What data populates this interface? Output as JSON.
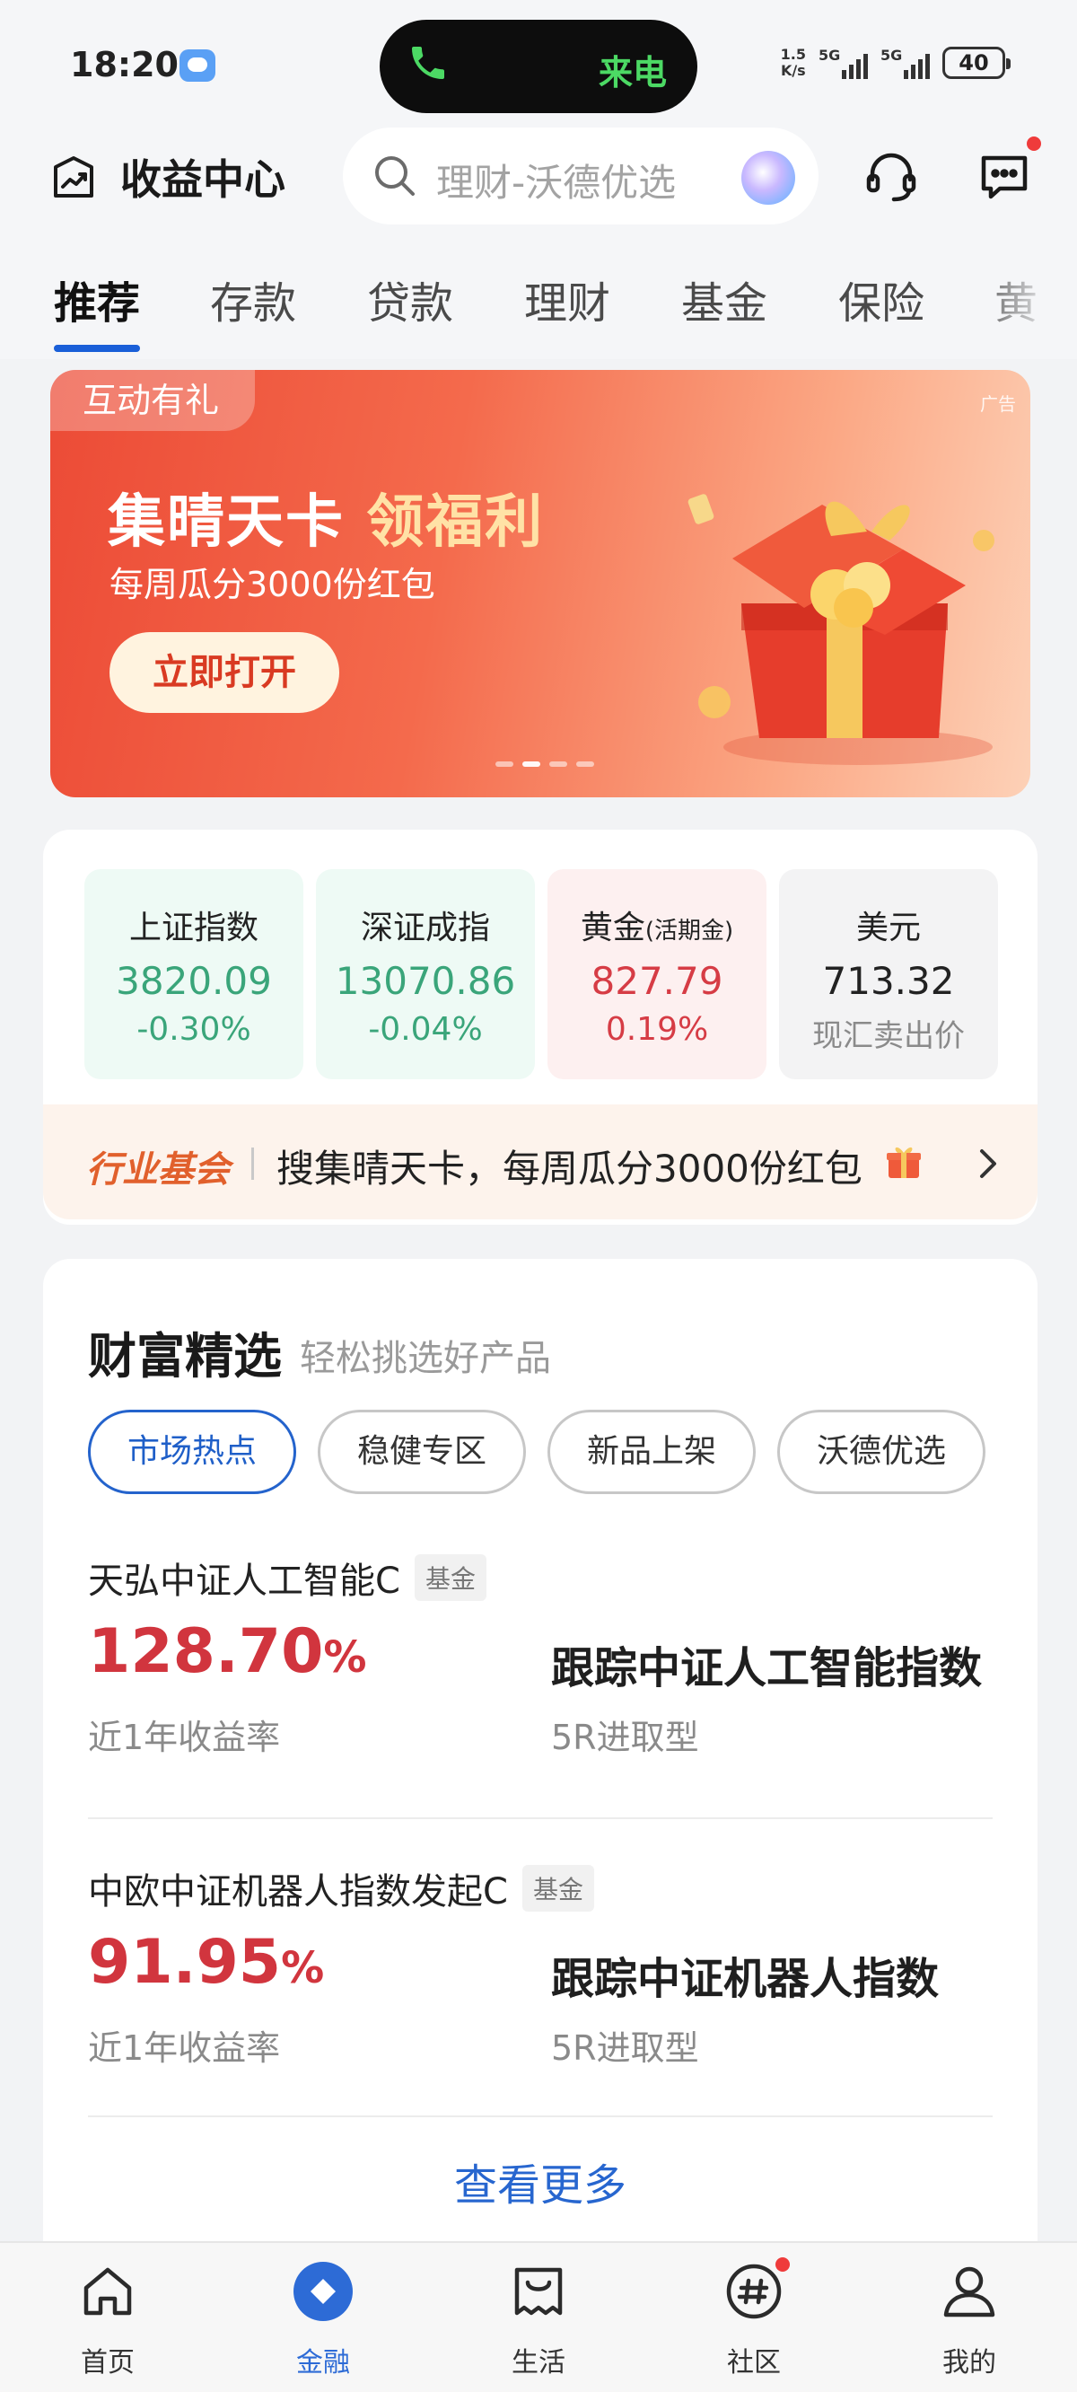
{
  "status_bar": {
    "time": "18:20",
    "call_label": "来电",
    "net_speed_value": "1.5",
    "net_speed_unit": "K/s",
    "signal_1": "5G",
    "signal_2": "5G",
    "battery": "40"
  },
  "header": {
    "title": "收益中心",
    "search_placeholder": "理财-沃德优选"
  },
  "tabs": [
    {
      "label": "推荐",
      "active": true
    },
    {
      "label": "存款"
    },
    {
      "label": "贷款"
    },
    {
      "label": "理财"
    },
    {
      "label": "基金"
    },
    {
      "label": "保险"
    },
    {
      "label": "黄"
    }
  ],
  "banner": {
    "tag": "互动有礼",
    "ad_label": "广告",
    "title_main": "集晴天卡",
    "title_highlight": "领福利",
    "subtitle": "每周瓜分3000份红包",
    "button": "立即打开",
    "slides": 4,
    "active_slide": 2
  },
  "market": [
    {
      "name": "上证指数",
      "value": "3820.09",
      "change": "-0.30%",
      "trend": "down"
    },
    {
      "name": "深证成指",
      "value": "13070.86",
      "change": "-0.04%",
      "trend": "down"
    },
    {
      "name": "黄金",
      "name_suffix": "(活期金)",
      "value": "827.79",
      "change": "0.19%",
      "trend": "up"
    },
    {
      "name": "美元",
      "value": "713.32",
      "change": "现汇卖出价",
      "trend": "neutral"
    }
  ],
  "ticker": {
    "brand": "行业基会",
    "text": "搜集晴天卡，每周瓜分3000份红包"
  },
  "wealth": {
    "title": "财富精选",
    "subtitle": "轻松挑选好产品",
    "chips": [
      {
        "label": "市场热点",
        "active": true
      },
      {
        "label": "稳健专区"
      },
      {
        "label": "新品上架"
      },
      {
        "label": "沃德优选"
      }
    ],
    "products": [
      {
        "name": "天弘中证人工智能C",
        "tag": "基金",
        "rate": "128.70",
        "rate_unit": "%",
        "rate_label": "近1年收益率",
        "desc": "跟踪中证人工智能指数",
        "risk": "5R进取型"
      },
      {
        "name": "中欧中证机器人指数发起C",
        "tag": "基金",
        "rate": "91.95",
        "rate_unit": "%",
        "rate_label": "近1年收益率",
        "desc": "跟踪中证机器人指数",
        "risk": "5R进取型"
      }
    ],
    "see_more": "查看更多"
  },
  "bottom_nav": [
    {
      "label": "首页",
      "icon": "home-icon"
    },
    {
      "label": "金融",
      "icon": "finance-icon",
      "active": true
    },
    {
      "label": "生活",
      "icon": "life-icon"
    },
    {
      "label": "社区",
      "icon": "community-icon",
      "badge": true
    },
    {
      "label": "我的",
      "icon": "profile-icon"
    }
  ],
  "colors": {
    "accent_blue": "#1a5fd8",
    "down_green": "#3aa57a",
    "up_red": "#d63c45",
    "banner_red": "#ec4b36"
  }
}
